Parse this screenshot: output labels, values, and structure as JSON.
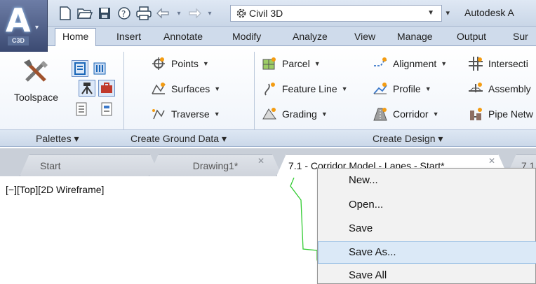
{
  "app": {
    "badge": "C3D",
    "workspace": "Civil 3D",
    "title": "Autodesk A"
  },
  "ribbon_tabs": [
    "Home",
    "Insert",
    "Annotate",
    "Modify",
    "Analyze",
    "View",
    "Manage",
    "Output",
    "Sur"
  ],
  "palettes": {
    "toolspace_label": "Toolspace",
    "panel_title": "Palettes ▾"
  },
  "ground_data": {
    "items": [
      "Points",
      "Surfaces",
      "Traverse"
    ],
    "panel_title": "Create Ground Data ▾"
  },
  "design": {
    "col1": [
      "Parcel",
      "Feature Line",
      "Grading"
    ],
    "col2": [
      "Alignment",
      "Profile",
      "Corridor"
    ],
    "col3": [
      "Intersecti",
      "Assembly",
      "Pipe Netw"
    ],
    "panel_title": "Create Design ▾"
  },
  "doc_tabs": [
    "Start",
    "Drawing1*",
    "7.1 - Corridor Model - Lanes - Start*",
    "7.1"
  ],
  "viewport_label": "[−][Top][2D Wireframe]",
  "context_menu": {
    "items": [
      "New...",
      "Open...",
      "Save",
      "Save As...",
      "Save All"
    ],
    "highlighted": "Save As..."
  },
  "colors": {
    "accent": "#3b4a72",
    "ribbon_bg": "#eef3fa",
    "menu_highlight": "#dbe9f7",
    "polyline": "#33cc33"
  }
}
